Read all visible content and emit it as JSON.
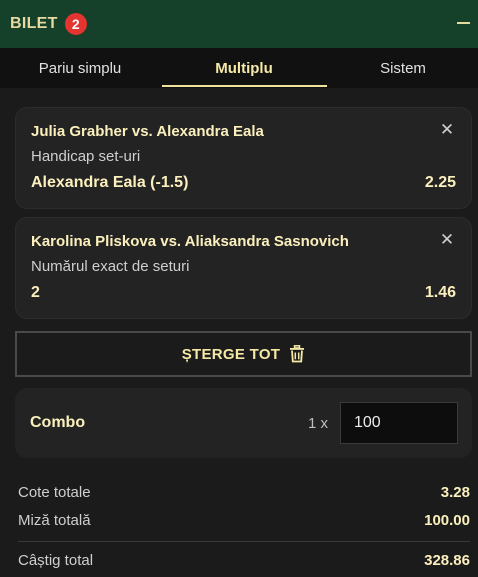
{
  "header": {
    "title": "BILET",
    "badge_count": "2"
  },
  "tabs": [
    {
      "label": "Pariu simplu",
      "active": false
    },
    {
      "label": "Multiplu",
      "active": true
    },
    {
      "label": "Sistem",
      "active": false
    }
  ],
  "bets": [
    {
      "match": "Julia Grabher vs. Alexandra Eala",
      "market": "Handicap set-uri",
      "selection": "Alexandra Eala (-1.5)",
      "odd": "2.25"
    },
    {
      "match": "Karolina Pliskova vs. Aliaksandra Sasnovich",
      "market": "Numărul exact de seturi",
      "selection": "2",
      "odd": "1.46"
    }
  ],
  "clear_all": {
    "label": "ȘTERGE TOT"
  },
  "combo": {
    "label": "Combo",
    "multiplier": "1 x",
    "stake": "100"
  },
  "summary": {
    "total_odds_label": "Cote totale",
    "total_odds": "3.28",
    "total_stake_label": "Miză totală",
    "total_stake": "100.00",
    "total_win_label": "Câștig total",
    "total_win": "328.86"
  },
  "colors": {
    "header_bg": "#15412a",
    "accent": "#f6e9a6",
    "badge": "#e3342f",
    "background": "#1b1b1b"
  }
}
